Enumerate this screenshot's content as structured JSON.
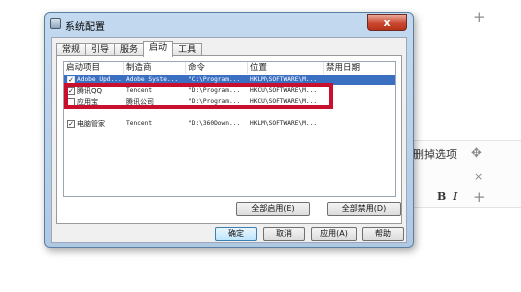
{
  "window": {
    "title": "系统配置",
    "close_symbol": "x"
  },
  "tabs": [
    {
      "label": "常规",
      "active": false
    },
    {
      "label": "引导",
      "active": false
    },
    {
      "label": "服务",
      "active": false
    },
    {
      "label": "启动",
      "active": true
    },
    {
      "label": "工具",
      "active": false
    }
  ],
  "list": {
    "headers": [
      "启动项目",
      "制造商",
      "命令",
      "位置",
      "禁用日期"
    ],
    "rows": [
      {
        "checked": true,
        "selected": true,
        "item": "Adobe Upd...",
        "vendor": "Adobe Syste...",
        "command": "\"C:\\Program...",
        "location": "HKLM\\SOFTWARE\\M..."
      },
      {
        "checked": true,
        "selected": false,
        "item": "腾讯QQ",
        "vendor": "Tencent",
        "command": "\"D:\\Program...",
        "location": "HKCU\\SOFTWARE\\M..."
      },
      {
        "checked": false,
        "selected": false,
        "item": "应用宝",
        "vendor": "腾讯公司",
        "command": "\"D:\\Program...",
        "location": "HKCU\\SOFTWARE\\M..."
      },
      {
        "checked": true,
        "selected": false,
        "item": "电脑管家",
        "vendor": "Tencent",
        "command": "\"D:\\360Down...",
        "location": "HKLM\\SOFTWARE\\M..."
      }
    ]
  },
  "panel_buttons": {
    "enable_all": "全部启用(E)",
    "disable_all": "全部禁用(D)"
  },
  "dialog_buttons": {
    "ok": "确定",
    "cancel": "取消",
    "apply": "应用(A)",
    "help": "帮助"
  },
  "background": {
    "plus": "+",
    "option_text": "删掉选项",
    "move_icon": "✥",
    "close_icon": "×",
    "bold": "B",
    "italic": "I"
  },
  "colors": {
    "highlight_box": "#c8102e",
    "selection": "#3b6fc2"
  }
}
